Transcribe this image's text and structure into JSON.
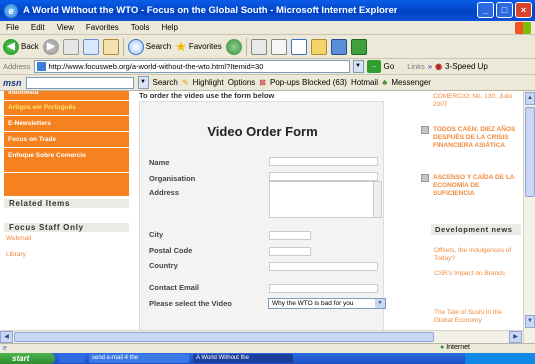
{
  "window": {
    "icon_letter": "e",
    "title": "A World Without the WTO - Focus on the Global South - Microsoft Internet Explorer",
    "minimize": "_",
    "maximize": "□",
    "close": "×"
  },
  "menu": [
    "File",
    "Edit",
    "View",
    "Favorites",
    "Tools",
    "Help"
  ],
  "toolbar": {
    "back_label": "Back",
    "search_label": "Search",
    "favorites_label": "Favorites"
  },
  "address": {
    "label": "Address",
    "url": "http://www.focusweb.org/a-world-without-the-wto.html?Itemid=30",
    "go_label": "Go",
    "links_label": "Links",
    "speedup_label": "3-Speed Up"
  },
  "msn": {
    "logo": "msn",
    "search_label": "Search",
    "highlight_label": "Highlight",
    "options_label": "Options",
    "popups_label": "Pop-ups Blocked (63)",
    "hotmail_label": "Hotmail",
    "messenger_label": "Messenger"
  },
  "left": {
    "orange_items": [
      "Indonesia",
      "Artigos em Português",
      "E-Newsletters",
      "Focus on Trade",
      "Enfoque Sobre Comercio"
    ],
    "related_items": "Related Items",
    "focus_staff_only": "Focus Staff Only",
    "webmail": "Webmail",
    "library": "Library"
  },
  "main": {
    "order_instruction": "To order the video use the form below",
    "form_title": "Video Order Form",
    "labels": {
      "name": "Name",
      "organisation": "Organisation",
      "address": "Address",
      "city": "City",
      "postal_code": "Postal Code",
      "country": "Country",
      "contact_email": "Contact Email",
      "select_video": "Please select the Video"
    },
    "video_select_value": "Why the WTO is bad for you"
  },
  "right": {
    "top_fragment": "COMERCIO: No. 130, Julio 2007",
    "item1": "TODOS CAEN: DIEZ AÑOS DESPUÉS DE LA CRISIS FINANCIERA ASIÁTICA",
    "item2": "ASCENSO Y CAÍDA DE LA ECONOMÍA DE SUFICIENCIA",
    "development_news": "Development news",
    "link1": "Offsets, the Indulgences of Today?",
    "link2": "CSR's Impact on Brands",
    "link3": "The Tale of Sushi in the Global Economy"
  },
  "status": {
    "zone": "Internet"
  },
  "taskbar": {
    "start": "start",
    "task1": "send e-mail 4 the",
    "task2": "A World Without the"
  }
}
